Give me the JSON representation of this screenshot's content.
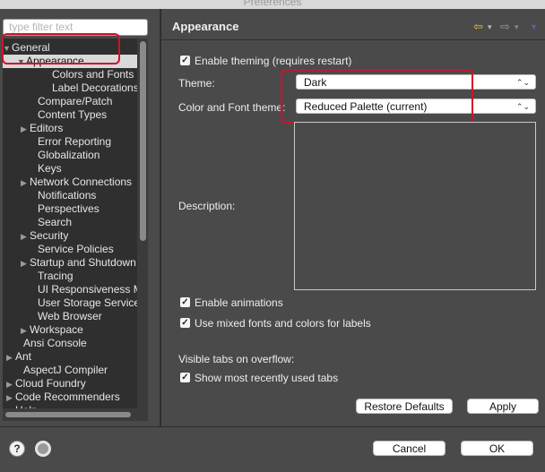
{
  "window": {
    "title": "Preferences"
  },
  "sidebar": {
    "filter_placeholder": "type filter text",
    "tree": [
      {
        "label": "General",
        "toggle": "▼"
      },
      {
        "label": "Appearance",
        "toggle": "▼"
      },
      {
        "label": "Colors and Fonts",
        "toggle": ""
      },
      {
        "label": "Label Decorations",
        "toggle": ""
      },
      {
        "label": "Compare/Patch",
        "toggle": ""
      },
      {
        "label": "Content Types",
        "toggle": ""
      },
      {
        "label": "Editors",
        "toggle": "▶"
      },
      {
        "label": "Error Reporting",
        "toggle": ""
      },
      {
        "label": "Globalization",
        "toggle": ""
      },
      {
        "label": "Keys",
        "toggle": ""
      },
      {
        "label": "Network Connections",
        "toggle": "▶"
      },
      {
        "label": "Notifications",
        "toggle": ""
      },
      {
        "label": "Perspectives",
        "toggle": ""
      },
      {
        "label": "Search",
        "toggle": ""
      },
      {
        "label": "Security",
        "toggle": "▶"
      },
      {
        "label": "Service Policies",
        "toggle": ""
      },
      {
        "label": "Startup and Shutdown",
        "toggle": "▶"
      },
      {
        "label": "Tracing",
        "toggle": ""
      },
      {
        "label": "UI Responsiveness Mo",
        "toggle": ""
      },
      {
        "label": "User Storage Service",
        "toggle": ""
      },
      {
        "label": "Web Browser",
        "toggle": ""
      },
      {
        "label": "Workspace",
        "toggle": "▶"
      },
      {
        "label": "Ansi Console",
        "toggle": ""
      },
      {
        "label": "Ant",
        "toggle": "▶"
      },
      {
        "label": "AspectJ Compiler",
        "toggle": ""
      },
      {
        "label": "Cloud Foundry",
        "toggle": "▶"
      },
      {
        "label": "Code Recommenders",
        "toggle": "▶"
      },
      {
        "label": "Help",
        "toggle": "▶"
      }
    ]
  },
  "page": {
    "title": "Appearance",
    "enable_theming_label": "Enable theming (requires restart)",
    "theme_label": "Theme:",
    "theme_value": "Dark",
    "color_font_theme_label": "Color and Font theme:",
    "color_font_theme_value": "Reduced Palette (current)",
    "description_label": "Description:",
    "enable_animations_label": "Enable animations",
    "mixed_fonts_label": "Use mixed fonts and colors for labels",
    "visible_tabs_label": "Visible tabs on overflow:",
    "recent_tabs_label": "Show most recently used tabs",
    "restore_defaults_label": "Restore Defaults",
    "apply_label": "Apply"
  },
  "dialog": {
    "cancel_label": "Cancel",
    "ok_label": "OK"
  },
  "icons": {
    "check": "✓",
    "back_arrow": "⇦",
    "forward_arrow": "⇨",
    "dropdown": "▾",
    "menu": "▼",
    "combo_chevron": "⌃⌄"
  },
  "colors": {
    "accent": "#d0122b",
    "nav_back": "#e6c42b",
    "nav_menu": "#7a4ea8"
  }
}
